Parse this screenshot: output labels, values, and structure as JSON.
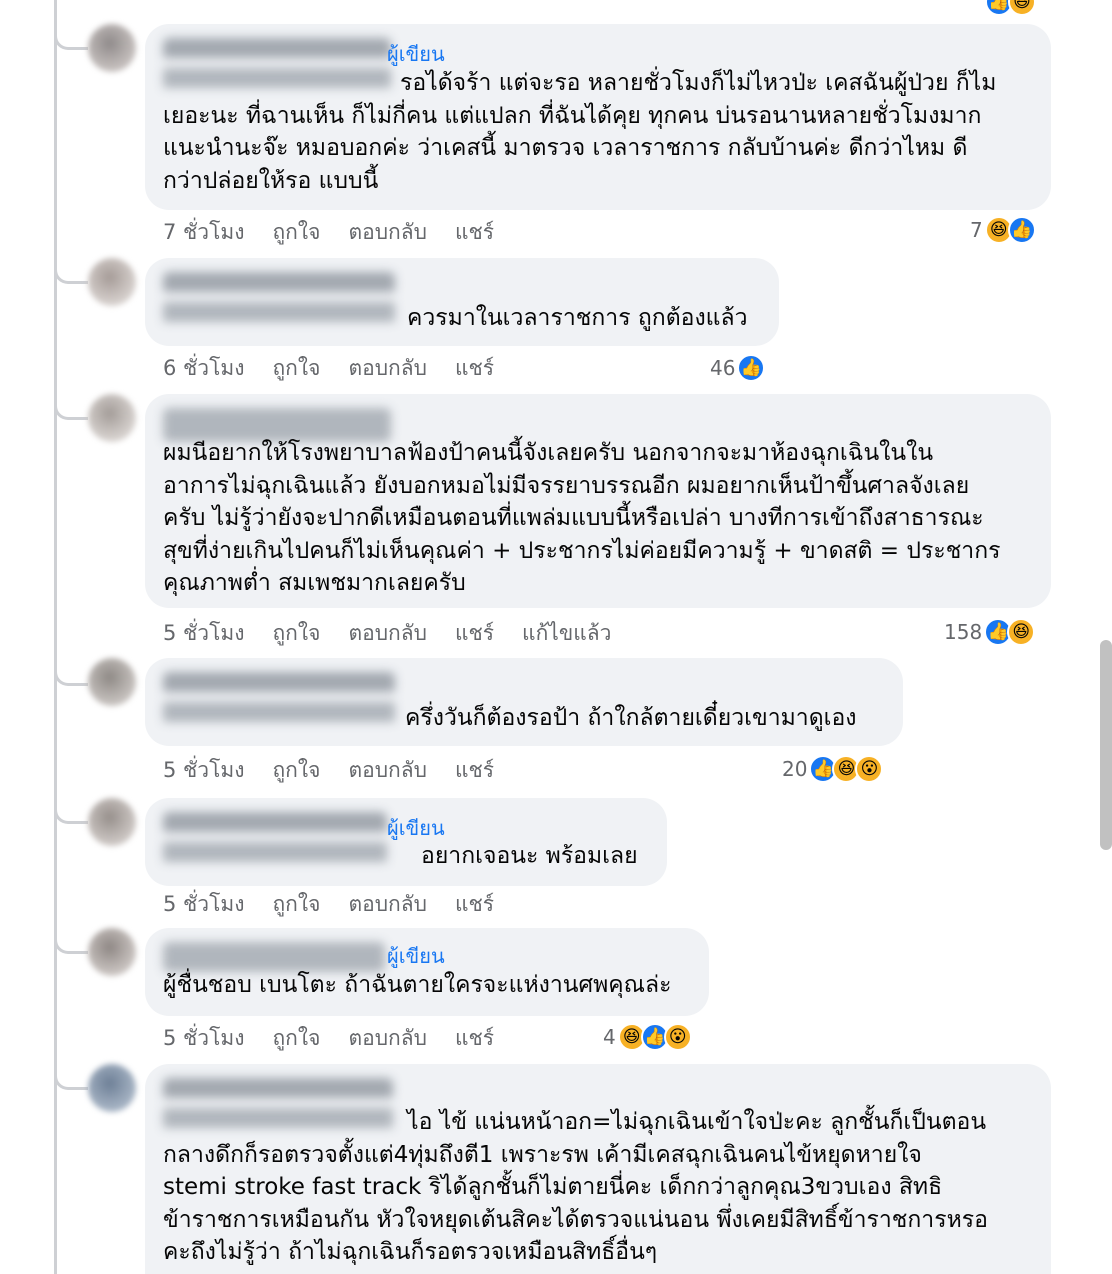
{
  "author_label": "ผู้เขียน",
  "actions": {
    "like": "ถูกใจ",
    "reply": "ตอบกลับ",
    "share": "แชร์"
  },
  "comments": [
    {
      "text": "รอได้จร้า แต่จะรอ หลายชั่วโมงก็ไม่ไหวป่ะ เคสฉันผู้ป่วย ก็ไม\nเยอะนะ ที่ฉานเห็น ก็ไม่กี่คน แต่แปลก ที่ฉันได้คุย ทุกคน บ่นรอนานหลายชั่วโมงมาก\nแนะนำนะจ๊ะ หมอบอกค่ะ ว่าเคสนี้ มาตรวจ เวลาราชการ กลับบ้านค่ะ ดีกว่าไหม ดี\nกว่าปล่อยให้รอ แบบนี้",
      "time": "7 ชั่วโมง",
      "reaction_count": "7",
      "reactions": [
        "haha-icon",
        "like-icon"
      ]
    },
    {
      "text": "ควรมาในเวลาราชการ ถูกต้องแล้ว",
      "time": "6 ชั่วโมง",
      "reaction_count": "46",
      "reactions": [
        "like-icon"
      ]
    },
    {
      "text": "ผมนีอยากให้โรงพยาบาลฟ้องป้าคนนี้จังเลยครับ นอกจากจะมาห้องฉุกเฉินในใน\nอาการไม่ฉุกเฉินแล้ว ยังบอกหมอไม่มีจรรยาบรรณอีก ผมอยากเห็นป้าขึ้นศาลจังเลย\nครับ ไม่รู้ว่ายังจะปากดีเหมือนตอนที่แพล่มแบบนี้หรือเปล่า บางทีการเข้าถึงสาธารณะ\nสุขที่ง่ายเกินไปคนก็ไม่เห็นคุณค่า + ประชากรไม่ค่อยมีความรู้ + ขาดสติ = ประชากร\nคุณภาพต่ำ สมเพชมากเลยครับ",
      "time": "5 ชั่วโมง",
      "edited": "แก้ไขแล้ว",
      "reaction_count": "158",
      "reactions": [
        "like-icon",
        "haha-icon"
      ]
    },
    {
      "text": "ครึ่งวันก็ต้องรอป้า ถ้าใกล้ตายเดี๋ยวเขามาดูเอง",
      "time": "5 ชั่วโมง",
      "reaction_count": "20",
      "reactions": [
        "like-icon",
        "haha-icon",
        "wow-icon"
      ]
    },
    {
      "text": "อยากเจอนะ พร้อมเลย",
      "time": "5 ชั่วโมง",
      "reaction_count": "",
      "reactions": []
    },
    {
      "text": "ผู้ชื่นชอบ เบนโตะ ถ้าฉันตายใครจะแห่งานศพคุณล่ะ",
      "time": "5 ชั่วโมง",
      "reaction_count": "4",
      "reactions": [
        "haha-icon",
        "like-icon",
        "wow-icon"
      ]
    },
    {
      "text": "ไอ ไข้ แน่นหน้าอก=ไม่ฉุกเฉินเข้าใจป่ะคะ ลูกชั้นก็เป็นตอน\nกลางดึกก็รอตรวจตั้งแต่4ทุ่มถึงตี1 เพราะรพ เค้ามีเคสฉุกเฉินคนไข้หยุดหายใจ\nstemi stroke fast track ริได้ลูกชั้นก็ไม่ตายนี่คะ เด็กกว่าลูกคุณ3ขวบเอง สิทธิ\nข้าราชการเหมือนกัน หัวใจหยุดเต้นสิคะได้ตรวจแน่นอน พึ่งเคยมีสิทธิ์ข้าราชการหรอ\nคะถึงไม่รู้ว่า ถ้าไม่ฉุกเฉินก็รอตรวจเหมือนสิทธิ์อื่นๆ",
      "time": "",
      "reaction_count": "",
      "reactions": []
    }
  ]
}
